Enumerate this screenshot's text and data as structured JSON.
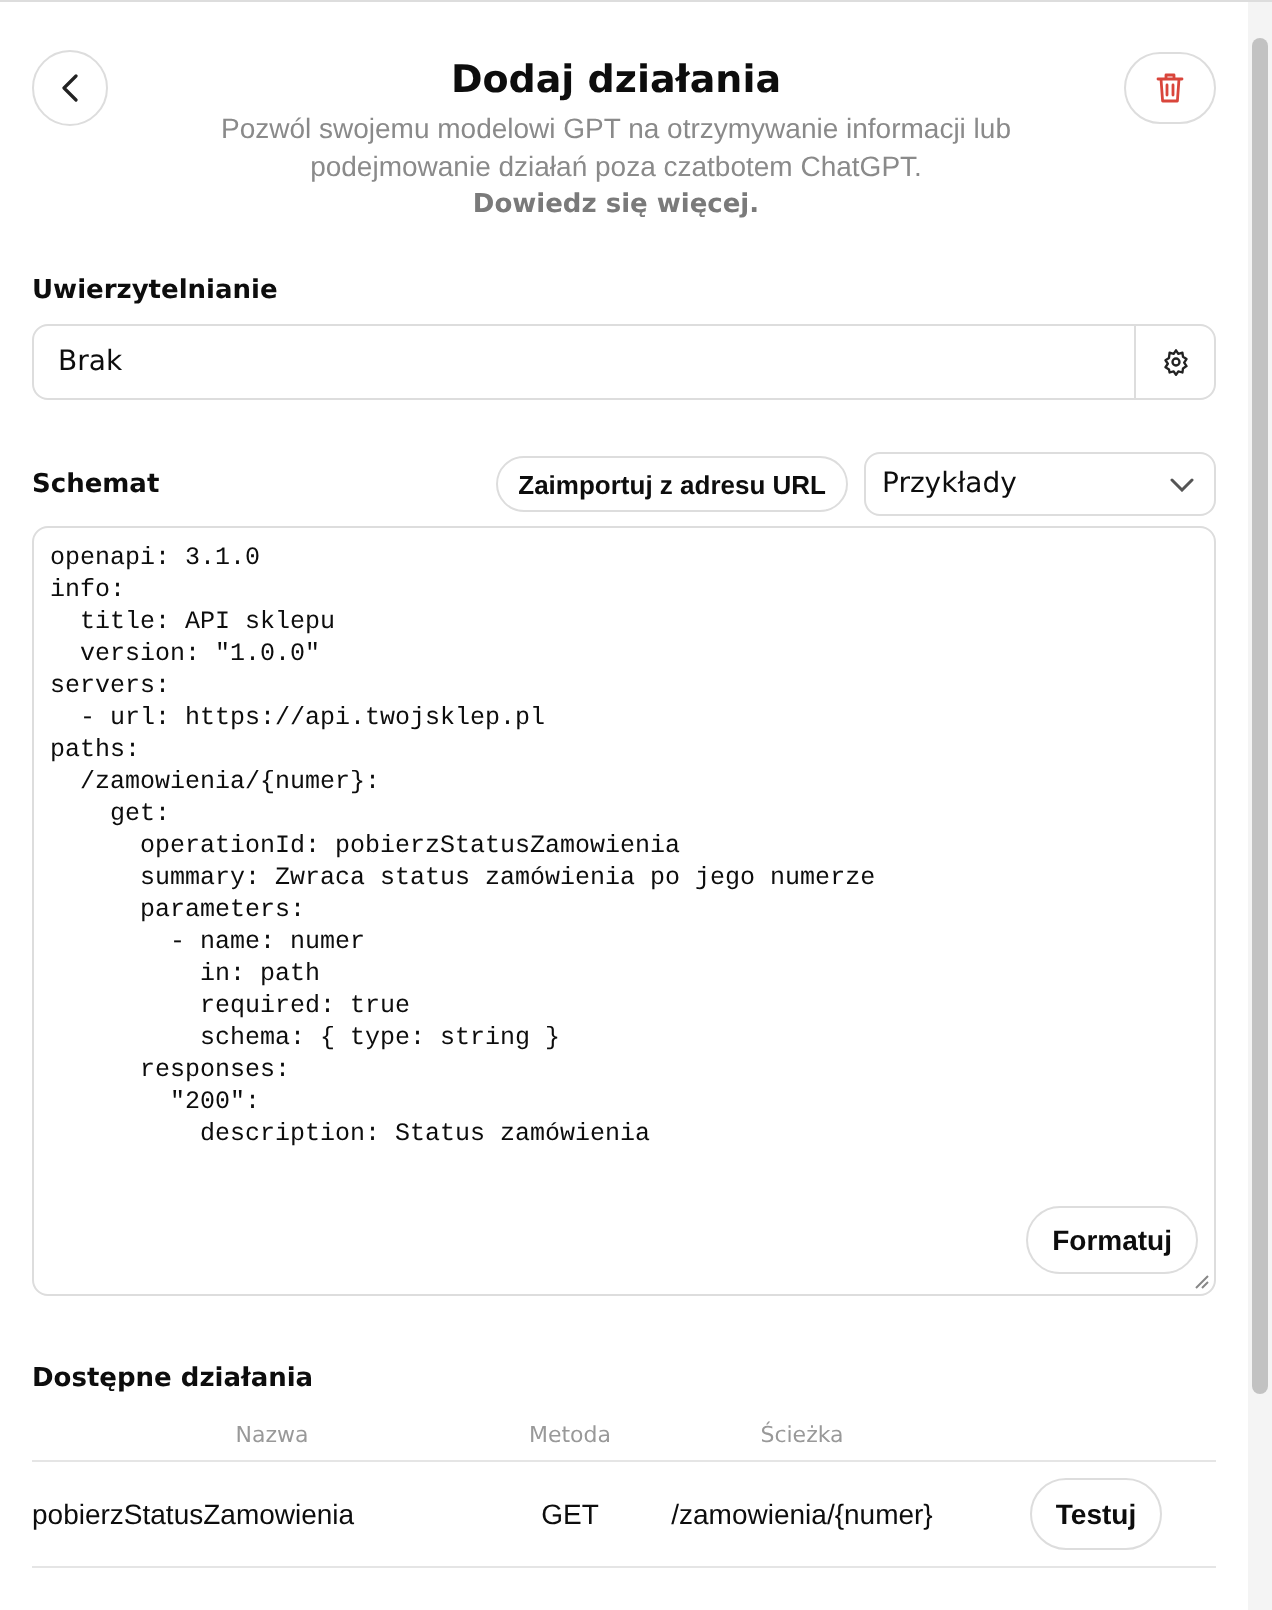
{
  "header": {
    "title": "Dodaj działania",
    "description": "Pozwól swojemu modelowi GPT na otrzymywanie informacji lub podejmowanie działań poza czatbotem ChatGPT.",
    "learn_more": "Dowiedz się więcej."
  },
  "authentication": {
    "label": "Uwierzytelnianie",
    "value": "Brak"
  },
  "schema": {
    "label": "Schemat",
    "import_button": "Zaimportuj z adresu URL",
    "examples_dropdown": "Przykłady",
    "format_button": "Formatuj",
    "code_lines": [
      "openapi: 3.1.0",
      "info:",
      "  title: API sklepu",
      "  version: \"1.0.0\"",
      "servers:",
      "  - url: https://api.twojsklep.pl",
      "paths:",
      "  /zamowienia/{numer}:",
      "    get:",
      "      operationId: pobierzStatusZamowienia",
      "      summary: Zwraca status zamówienia po jego numerze",
      "      parameters:",
      "        - name: numer",
      "          in: path",
      "          required: true",
      "          schema: { type: string }",
      "      responses:",
      "        \"200\":",
      "          description: Status zamówienia"
    ]
  },
  "available_actions": {
    "label": "Dostępne działania",
    "columns": [
      "Nazwa",
      "Metoda",
      "Ścieżka"
    ],
    "rows": [
      {
        "name": "pobierzStatusZamowienia",
        "method": "GET",
        "path": "/zamowienia/{numer}",
        "button": "Testuj"
      }
    ]
  }
}
